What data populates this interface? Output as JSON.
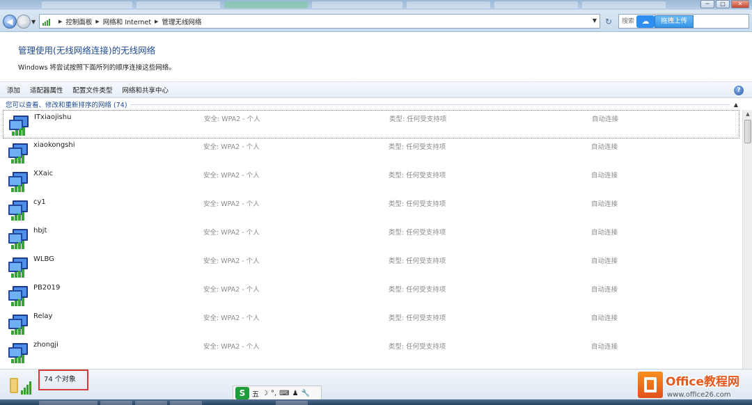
{
  "window": {
    "controls": {
      "minimize": "─",
      "maximize": "□",
      "close": "✕"
    }
  },
  "address_bar": {
    "breadcrumbs": [
      "控制面板",
      "网络和 Internet",
      "管理无线网络"
    ],
    "search_placeholder": "搜索"
  },
  "upload": {
    "label": "拖拽上传"
  },
  "header": {
    "title": "管理使用(无线网络连接)的无线网络",
    "subtitle": "Windows 将尝试按照下面所列的顺序连接这些网络。"
  },
  "toolbar": {
    "items": [
      "添加",
      "适配器属性",
      "配置文件类型",
      "网络和共享中心"
    ]
  },
  "group": {
    "label": "您可以查看、修改和重新排序的网络 (74)"
  },
  "networks": [
    {
      "name": "ITxiaojishu",
      "security": "安全: WPA2 - 个人",
      "type": "类型: 任何受支持项",
      "mode": "自动连接"
    },
    {
      "name": "xiaokongshi",
      "security": "安全: WPA2 - 个人",
      "type": "类型: 任何受支持项",
      "mode": "自动连接"
    },
    {
      "name": "XXaic",
      "security": "安全: WPA2 - 个人",
      "type": "类型: 任何受支持项",
      "mode": "自动连接"
    },
    {
      "name": "cy1",
      "security": "安全: WPA2 - 个人",
      "type": "类型: 任何受支持项",
      "mode": "自动连接"
    },
    {
      "name": "hbjt",
      "security": "安全: WPA2 - 个人",
      "type": "类型: 任何受支持项",
      "mode": "自动连接"
    },
    {
      "name": "WLBG",
      "security": "安全: WPA2 - 个人",
      "type": "类型: 任何受支持项",
      "mode": "自动连接"
    },
    {
      "name": "PB2019",
      "security": "安全: WPA2 - 个人",
      "type": "类型: 任何受支持项",
      "mode": "自动连接"
    },
    {
      "name": "Relay",
      "security": "安全: WPA2 - 个人",
      "type": "类型: 任何受支持项",
      "mode": "自动连接"
    },
    {
      "name": "zhongji",
      "security": "安全: WPA2 - 个人",
      "type": "类型: 任何受支持项",
      "mode": "自动连接"
    }
  ],
  "status": {
    "count": "74 个对象"
  },
  "ime": {
    "logo": "S",
    "mode": "五",
    "items": [
      "☽",
      "°,",
      "⌨",
      "♟",
      "🔧"
    ]
  },
  "watermark": {
    "brand": "Office教程网",
    "url": "www.office26.com"
  }
}
